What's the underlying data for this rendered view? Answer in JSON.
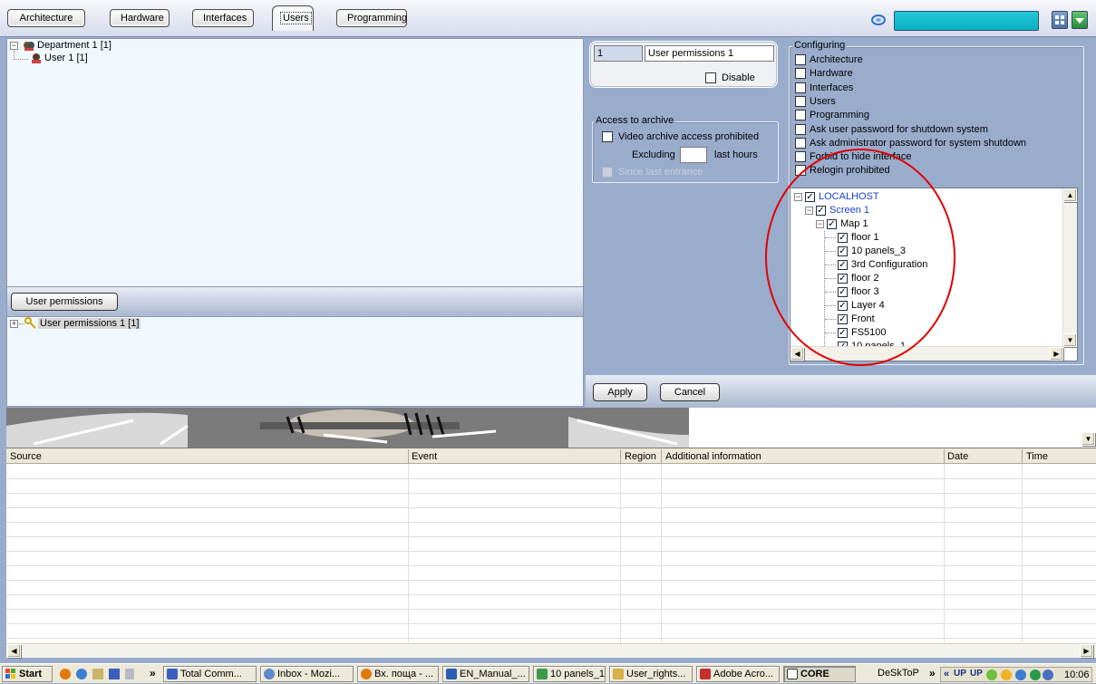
{
  "top_tabs": [
    "Architecture",
    "Hardware",
    "Interfaces",
    "Users",
    "Programming"
  ],
  "active_tab": "Users",
  "user_tree": {
    "department": "Department 1 [1]",
    "user": "User 1 [1]"
  },
  "permissions_header": "User permissions",
  "permissions_tree": {
    "item": "User permissions 1 [1]"
  },
  "config": {
    "id_value": "1",
    "name_value": "User permissions 1",
    "disable_label": "Disable",
    "access_archive": {
      "title": "Access to archive",
      "video_prohibited": "Video archive access prohibited",
      "excluding": "Excluding",
      "last_hours": "last hours",
      "since_last": "Since last entrance"
    },
    "configuring": {
      "title": "Configuring",
      "items": [
        "Architecture",
        "Hardware",
        "Interfaces",
        "Users",
        "Programming",
        "Ask user password for shutdown system",
        "Ask administrator password for system  shutdown",
        "Forbid to hide interface",
        "Relogin prohibited"
      ]
    },
    "access_tree": [
      {
        "label": "LOCALHOST",
        "level": 0,
        "blue": true
      },
      {
        "label": "Screen 1",
        "level": 1,
        "blue": true
      },
      {
        "label": "Map 1",
        "level": 2,
        "blue": false
      },
      {
        "label": "floor 1",
        "level": 3,
        "blue": false
      },
      {
        "label": "10 panels_3",
        "level": 3,
        "blue": false
      },
      {
        "label": "3rd Configuration",
        "level": 3,
        "blue": false
      },
      {
        "label": "floor 2",
        "level": 3,
        "blue": false
      },
      {
        "label": "floor 3",
        "level": 3,
        "blue": false
      },
      {
        "label": "Layer 4",
        "level": 3,
        "blue": false
      },
      {
        "label": "Front",
        "level": 3,
        "blue": false
      },
      {
        "label": "FS5100",
        "level": 3,
        "blue": false
      },
      {
        "label": "10 panels_1",
        "level": 3,
        "blue": false
      }
    ],
    "apply": "Apply",
    "cancel": "Cancel"
  },
  "events_table": {
    "columns": [
      "Source",
      "Event",
      "Region",
      "Additional information",
      "Date",
      "Time"
    ]
  },
  "taskbar": {
    "start": "Start",
    "tasks": [
      "Total Comm...",
      "Inbox - Mozi...",
      "Вх. поща - ...",
      "EN_Manual_...",
      "10 panels_1",
      "User_rights...",
      "Adobe Acro...",
      "CORE"
    ],
    "desktop_label": "DeSkToP",
    "clock": "10:06"
  },
  "colors": {
    "panel_bg": "#9aaccc",
    "tree_bg": "#f1f8fd",
    "highlight_circle": "#e00000",
    "search_box": "#12bccd"
  }
}
